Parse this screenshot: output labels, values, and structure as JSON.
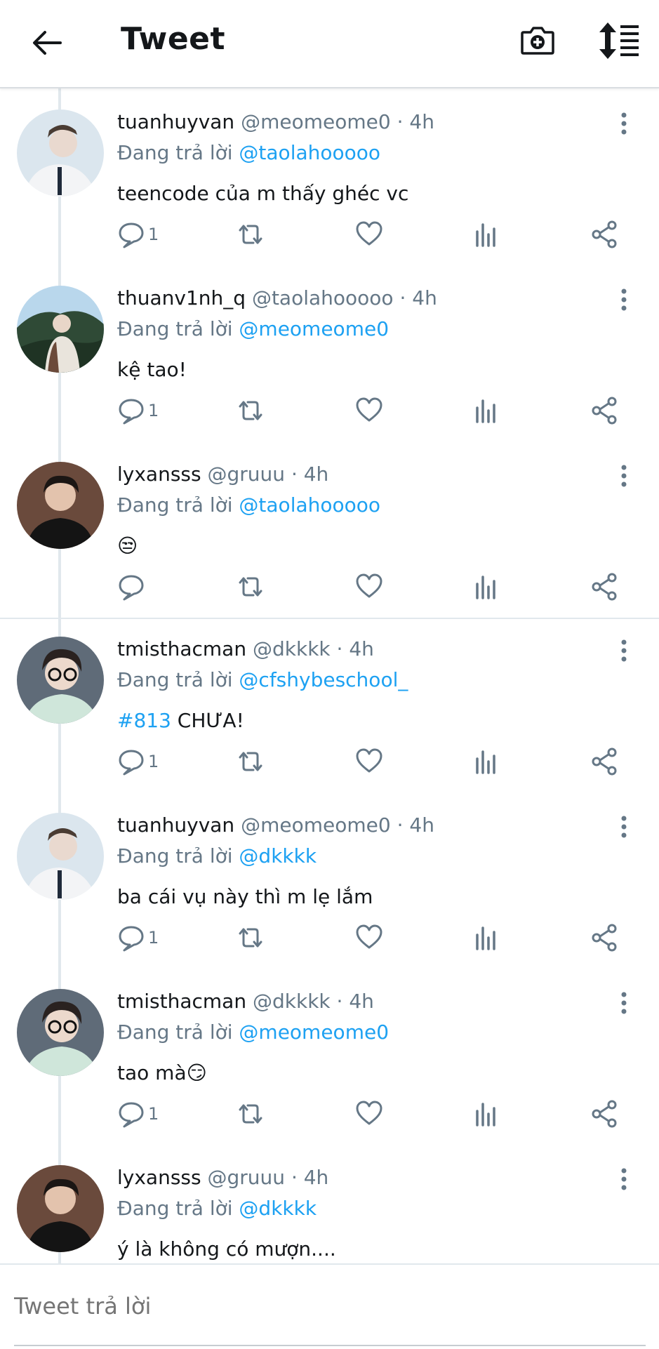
{
  "header": {
    "title": "Tweet",
    "icons": [
      "back-arrow-icon",
      "camera-add-icon",
      "sort-icon"
    ]
  },
  "colors": {
    "mention": "#1da1f2",
    "secondary_text": "#657786",
    "primary_text": "#14171a"
  },
  "replying_prefix": "Đang trả lời",
  "tweets": [
    {
      "name": "tuanhuyvan",
      "handle": "@meomeome0",
      "time": "· 4h",
      "reply_to": "@taolahooooo",
      "text": "teencode của m thấy ghéc vc",
      "reply_count": "1"
    },
    {
      "name": "thuanv1nh_q",
      "handle": "@taolahooooo",
      "time": "· 4h",
      "reply_to": "@meomeome0",
      "text": "kệ tao!",
      "reply_count": "1"
    },
    {
      "name": "lyxansss",
      "handle": "@gruuu",
      "time": "· 4h",
      "reply_to": "@taolahooooo",
      "text": "😒",
      "reply_count": ""
    },
    {
      "name": "tmisthacman",
      "handle": "@dkkkk",
      "time": "· 4h",
      "reply_to": "@cfshybeschool_",
      "hashtag": "#813",
      "text": " CHƯA!",
      "reply_count": "1"
    },
    {
      "name": "tuanhuyvan",
      "handle": "@meomeome0",
      "time": "· 4h",
      "reply_to": "@dkkkk",
      "text": "ba cái vụ này thì m lẹ lắm",
      "reply_count": "1"
    },
    {
      "name": "tmisthacman",
      "handle": "@dkkkk",
      "time": "· 4h",
      "reply_to": "@meomeome0",
      "text": "tao mà😏",
      "reply_count": "1"
    },
    {
      "name": "lyxansss",
      "handle": "@gruuu",
      "time": "· 4h",
      "reply_to": "@dkkkk",
      "text": "ý là không có mượn....",
      "reply_count": ""
    }
  ],
  "composer": {
    "placeholder": "Tweet trả lời"
  }
}
